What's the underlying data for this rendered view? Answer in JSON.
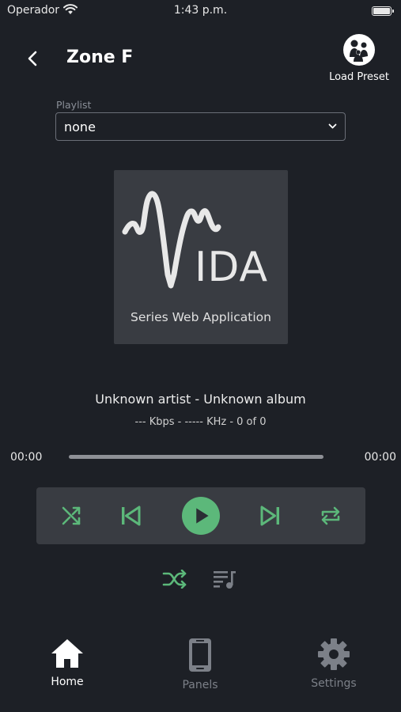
{
  "status_bar": {
    "carrier": "Operador",
    "time": "1:43 p.m."
  },
  "header": {
    "title": "Zone F",
    "back_icon": "chevron-left-icon",
    "preset_label": "Load Preset",
    "preset_icon": "people-group-icon"
  },
  "playlist": {
    "label": "Playlist",
    "value": "none"
  },
  "album_art": {
    "logo_text": "IDA",
    "logo_caption": "Series Web Application"
  },
  "track": {
    "title": "Unknown artist - Unknown album",
    "info": "--- Kbps - ----- KHz - 0 of 0"
  },
  "progress": {
    "elapsed": "00:00",
    "duration": "00:00",
    "fraction": 0
  },
  "controls": {
    "shuffle_icon": "shuffle-icon",
    "previous_icon": "skip-previous-icon",
    "play_icon": "play-icon",
    "next_icon": "skip-next-icon",
    "repeat_icon": "repeat-icon"
  },
  "sub_controls": {
    "crossfade_icon": "crossfade-icon",
    "queue_icon": "playlist-music-icon"
  },
  "nav": {
    "items": [
      {
        "label": "Home",
        "icon": "home-icon",
        "active": true
      },
      {
        "label": "Panels",
        "icon": "tablet-icon",
        "active": false
      },
      {
        "label": "Settings",
        "icon": "gear-icon",
        "active": false
      }
    ]
  },
  "colors": {
    "background": "#1d2026",
    "panel": "#393c42",
    "accent": "#5cb87a",
    "inactive": "#7c8088"
  }
}
